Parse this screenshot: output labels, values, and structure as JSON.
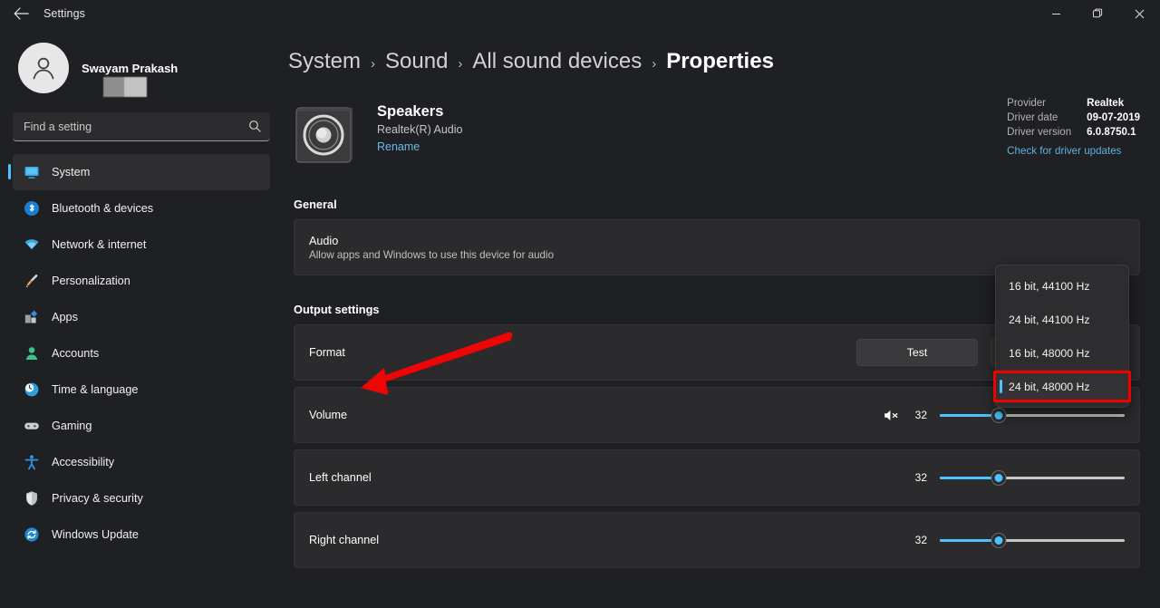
{
  "window": {
    "title": "Settings",
    "back_icon": "back-arrow-icon",
    "minimize_label": "—",
    "maximize_label": "❐",
    "close_label": "✕"
  },
  "sidebar": {
    "profile": {
      "name": "Swayam Prakash",
      "avatar_icon": "user-avatar-icon"
    },
    "search": {
      "placeholder": "Find a setting",
      "value": "",
      "icon": "search-icon"
    },
    "items": [
      {
        "label": "System",
        "icon": "system-monitor-icon",
        "active": true
      },
      {
        "label": "Bluetooth & devices",
        "icon": "bluetooth-icon",
        "active": false
      },
      {
        "label": "Network & internet",
        "icon": "wifi-icon",
        "active": false
      },
      {
        "label": "Personalization",
        "icon": "paintbrush-icon",
        "active": false
      },
      {
        "label": "Apps",
        "icon": "apps-icon",
        "active": false
      },
      {
        "label": "Accounts",
        "icon": "account-person-icon",
        "active": false
      },
      {
        "label": "Time & language",
        "icon": "clock-globe-icon",
        "active": false
      },
      {
        "label": "Gaming",
        "icon": "gamepad-icon",
        "active": false
      },
      {
        "label": "Accessibility",
        "icon": "accessibility-person-icon",
        "active": false
      },
      {
        "label": "Privacy & security",
        "icon": "shield-icon",
        "active": false
      },
      {
        "label": "Windows Update",
        "icon": "update-refresh-icon",
        "active": false
      }
    ]
  },
  "breadcrumb": {
    "items": [
      "System",
      "Sound",
      "All sound devices",
      "Properties"
    ],
    "separator": "›"
  },
  "device": {
    "name": "Speakers",
    "subtitle": "Realtek(R) Audio",
    "rename_label": "Rename",
    "icon": "speaker-device-icon"
  },
  "driver": {
    "provider_label": "Provider",
    "provider_value": "Realtek",
    "date_label": "Driver date",
    "date_value": "09-07-2019",
    "version_label": "Driver version",
    "version_value": "6.0.8750.1",
    "update_link": "Check for driver updates"
  },
  "general": {
    "heading": "General",
    "audio_title": "Audio",
    "audio_subtitle": "Allow apps and Windows to use this device for audio"
  },
  "output": {
    "heading": "Output settings",
    "format_label": "Format",
    "test_button": "Test",
    "format_selected": "24 bit, 48000 Hz",
    "format_options": [
      "16 bit, 44100 Hz",
      "24 bit, 44100 Hz",
      "16 bit, 48000 Hz",
      "24 bit, 48000 Hz"
    ],
    "volume": {
      "label": "Volume",
      "value": "32",
      "percent": 32,
      "icon": "speaker-muted-icon"
    },
    "left_channel": {
      "label": "Left channel",
      "value": "32",
      "percent": 32
    },
    "right_channel": {
      "label": "Right channel",
      "value": "32",
      "percent": 32
    }
  },
  "annotations": {
    "highlight_color": "#f10000",
    "arrow_target": "Format",
    "rect_target": "24 bit, 48000 Hz"
  }
}
